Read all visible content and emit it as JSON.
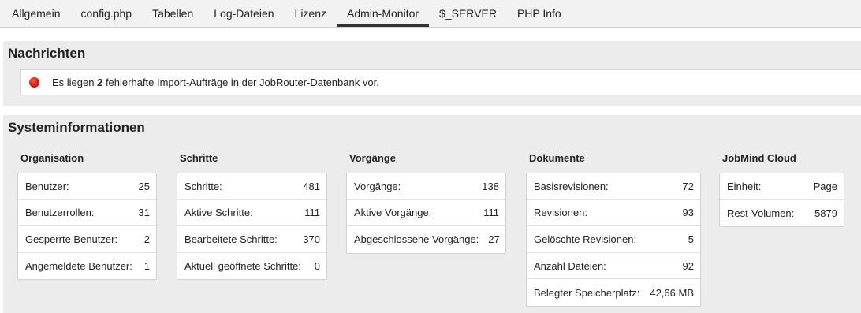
{
  "tabs": [
    {
      "label": "Allgemein",
      "active": false
    },
    {
      "label": "config.php",
      "active": false
    },
    {
      "label": "Tabellen",
      "active": false
    },
    {
      "label": "Log-Dateien",
      "active": false
    },
    {
      "label": "Lizenz",
      "active": false
    },
    {
      "label": "Admin-Monitor",
      "active": true
    },
    {
      "label": "$_SERVER",
      "active": false
    },
    {
      "label": "PHP Info",
      "active": false
    }
  ],
  "nachrichten": {
    "title": "Nachrichten",
    "message": {
      "status_color": "#e0150b",
      "text_before": "Es liegen ",
      "count": "2",
      "text_after": " fehlerhafte Import-Aufträge in der JobRouter-Datenbank vor."
    }
  },
  "systeminfo": {
    "title": "Systeminformationen",
    "groups": [
      {
        "title": "Organisation",
        "rows": [
          {
            "label": "Benutzer:",
            "value": "25"
          },
          {
            "label": "Benutzerrollen:",
            "value": "31"
          },
          {
            "label": "Gesperrte Benutzer:",
            "value": "2"
          },
          {
            "label": "Angemeldete Benutzer:",
            "value": "1"
          }
        ]
      },
      {
        "title": "Schritte",
        "rows": [
          {
            "label": "Schritte:",
            "value": "481"
          },
          {
            "label": "Aktive Schritte:",
            "value": "111"
          },
          {
            "label": "Bearbeitete Schritte:",
            "value": "370"
          },
          {
            "label": "Aktuell geöffnete Schritte:",
            "value": "0"
          }
        ]
      },
      {
        "title": "Vorgänge",
        "rows": [
          {
            "label": "Vorgänge:",
            "value": "138"
          },
          {
            "label": "Aktive Vorgänge:",
            "value": "111"
          },
          {
            "label": "Abgeschlossene Vorgänge:",
            "value": "27"
          }
        ]
      },
      {
        "title": "Dokumente",
        "rows": [
          {
            "label": "Basisrevisionen:",
            "value": "72"
          },
          {
            "label": "Revisionen:",
            "value": "93"
          },
          {
            "label": "Gelöschte Revisionen:",
            "value": "5"
          },
          {
            "label": "Anzahl Dateien:",
            "value": "92"
          },
          {
            "label": "Belegter Speicherplatz:",
            "value": "42,66 MB"
          }
        ]
      },
      {
        "title": "JobMind Cloud",
        "rows": [
          {
            "label": "Einheit:",
            "value": "Page"
          },
          {
            "label": "Rest-Volumen:",
            "value": "5879"
          }
        ]
      }
    ]
  }
}
